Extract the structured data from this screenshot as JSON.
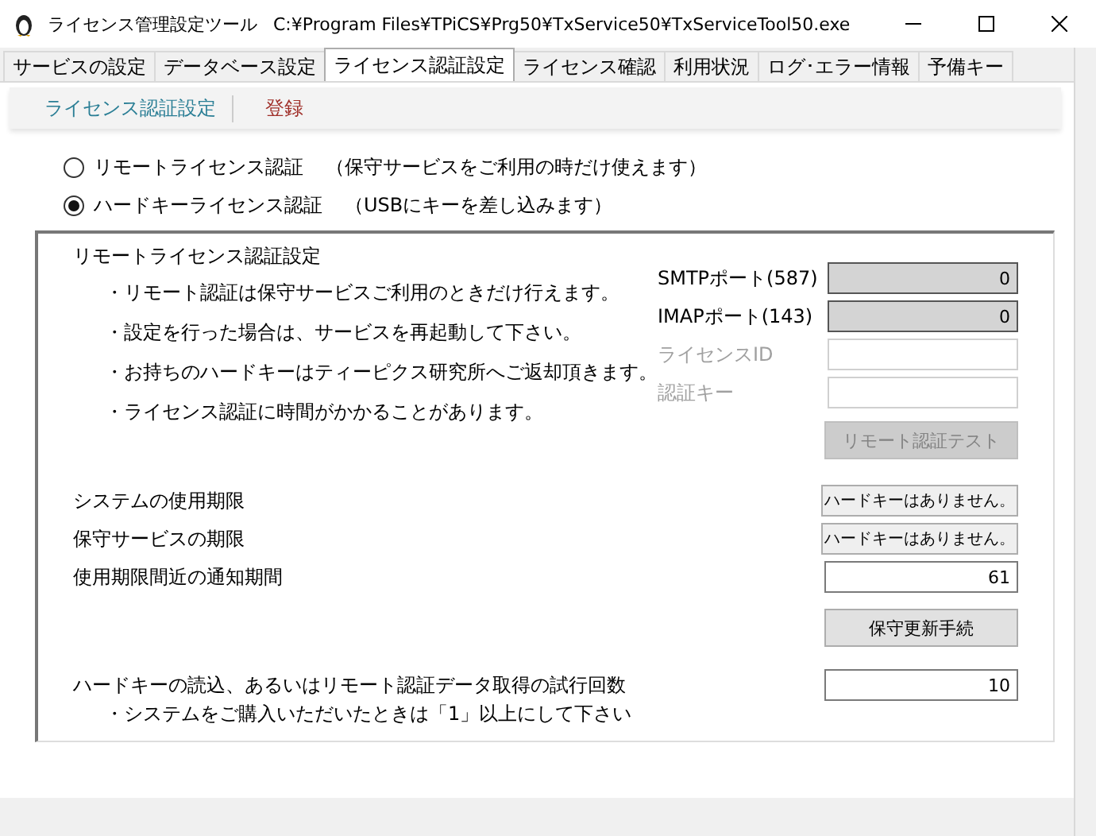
{
  "window": {
    "title": "ライセンス管理設定ツール",
    "path": "C:¥Program Files¥TPiCS¥Prg50¥TxService50¥TxServiceTool50.exe"
  },
  "tabs": [
    {
      "label": "サービスの設定",
      "selected": false
    },
    {
      "label": "データベース設定",
      "selected": false
    },
    {
      "label": "ライセンス認証設定",
      "selected": true
    },
    {
      "label": "ライセンス確認",
      "selected": false
    },
    {
      "label": "利用状況",
      "selected": false
    },
    {
      "label": "ログ･エラー情報",
      "selected": false
    },
    {
      "label": "予備キー",
      "selected": false
    }
  ],
  "toolbar": {
    "section_label": "ライセンス認証設定",
    "register_button": "登録"
  },
  "auth_modes": [
    {
      "label": "リモートライセンス認証",
      "note": "（保守サービスをご利用の時だけ使えます）",
      "selected": false
    },
    {
      "label": "ハードキーライセンス認証",
      "note": "（USBにキーを差し込みます）",
      "selected": true
    }
  ],
  "remote_group": {
    "title": "リモートライセンス認証設定",
    "notes": [
      "・リモート認証は保守サービスご利用のときだけ行えます。",
      "・設定を行った場合は、サービスを再起動して下さい。",
      "・お持ちのハードキーはティーピクス研究所へご返却頂きます。",
      "・ライセンス認証に時間がかかることがあります。"
    ],
    "fields": [
      {
        "label": "SMTPポート(587)",
        "value": "0",
        "disabled": false,
        "readonly": true
      },
      {
        "label": "IMAPポート(143)",
        "value": "0",
        "disabled": false,
        "readonly": true
      },
      {
        "label": "ライセンスID",
        "disabled": true,
        "readonly": false
      },
      {
        "label": "認証キー",
        "disabled": true,
        "readonly": false
      }
    ],
    "test_button": {
      "label": "リモート認証テスト",
      "disabled": true
    }
  },
  "settings": [
    {
      "label": "システムの使用期限",
      "kind": "button",
      "value": "ハードキーはありません。"
    },
    {
      "label": "保守サービスの期限",
      "kind": "button",
      "value": "ハードキーはありません。"
    },
    {
      "label": "使用期限間近の通知期間",
      "kind": "input",
      "value": "61"
    }
  ],
  "renew_button": "保守更新手続",
  "retry": {
    "label": "ハードキーの読込、あるいはリモート認証データ取得の試行回数",
    "value": "10",
    "note": "・システムをご購入いただいたときは「1」以上にして下さい"
  }
}
